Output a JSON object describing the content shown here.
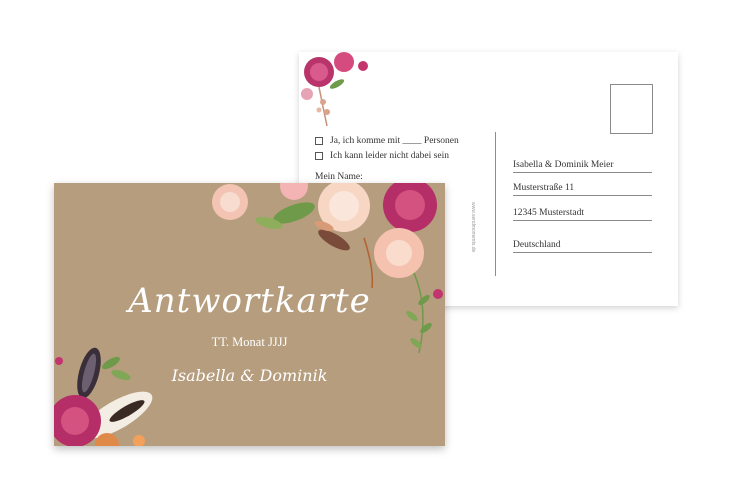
{
  "back_card": {
    "option_yes": "Ja, ich komme mit ____ Personen",
    "option_no": "Ich kann leider nicht dabei sein",
    "name_label": "Mein Name:",
    "url_vertical": "www.sendmoments.de",
    "address": [
      "Isabella & Dominik Meier",
      "Musterstraße 11",
      "12345 Musterstadt",
      "Deutschland"
    ]
  },
  "front_card": {
    "title": "Antwortkarte",
    "date": "TT. Monat JJJJ",
    "names": "Isabella & Dominik"
  },
  "colors": {
    "kraft_paper": "#b59d7e",
    "rose_magenta": "#c2356e",
    "blush_pink": "#f4c3b6",
    "leaf_green": "#6f9a4a"
  }
}
